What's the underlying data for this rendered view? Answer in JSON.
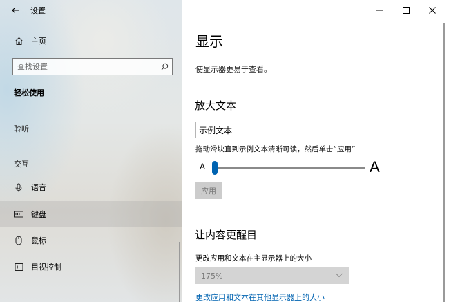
{
  "window": {
    "title": "设置"
  },
  "sidebar": {
    "home_label": "主页",
    "search_placeholder": "查找设置",
    "group_title": "轻松使用",
    "section_hearing": "聆听",
    "section_interaction": "交互",
    "items": [
      {
        "label": "语音",
        "icon": "microphone-icon"
      },
      {
        "label": "键盘",
        "icon": "keyboard-icon",
        "selected": true
      },
      {
        "label": "鼠标",
        "icon": "mouse-icon"
      },
      {
        "label": "目视控制",
        "icon": "eye-control-icon"
      }
    ]
  },
  "main": {
    "title": "显示",
    "subtitle": "使显示器更易于查看。",
    "enlarge_text": {
      "heading": "放大文本",
      "sample_text": "示例文本",
      "hint": "拖动滑块直到示例文本清晰可读，然后单击“应用”",
      "small_a": "A",
      "large_a": "A",
      "slider_value": 0,
      "apply_label": "应用"
    },
    "make_prominent": {
      "heading": "让内容更醒目",
      "size_label": "更改应用和文本在主显示器上的大小",
      "size_value": "175%",
      "other_displays_link": "更改应用和文本在其他显示器上的大小"
    }
  },
  "colors": {
    "accent": "#0063b1",
    "disabled_bg": "#cccccc",
    "disabled_text": "#7a7a7a"
  }
}
